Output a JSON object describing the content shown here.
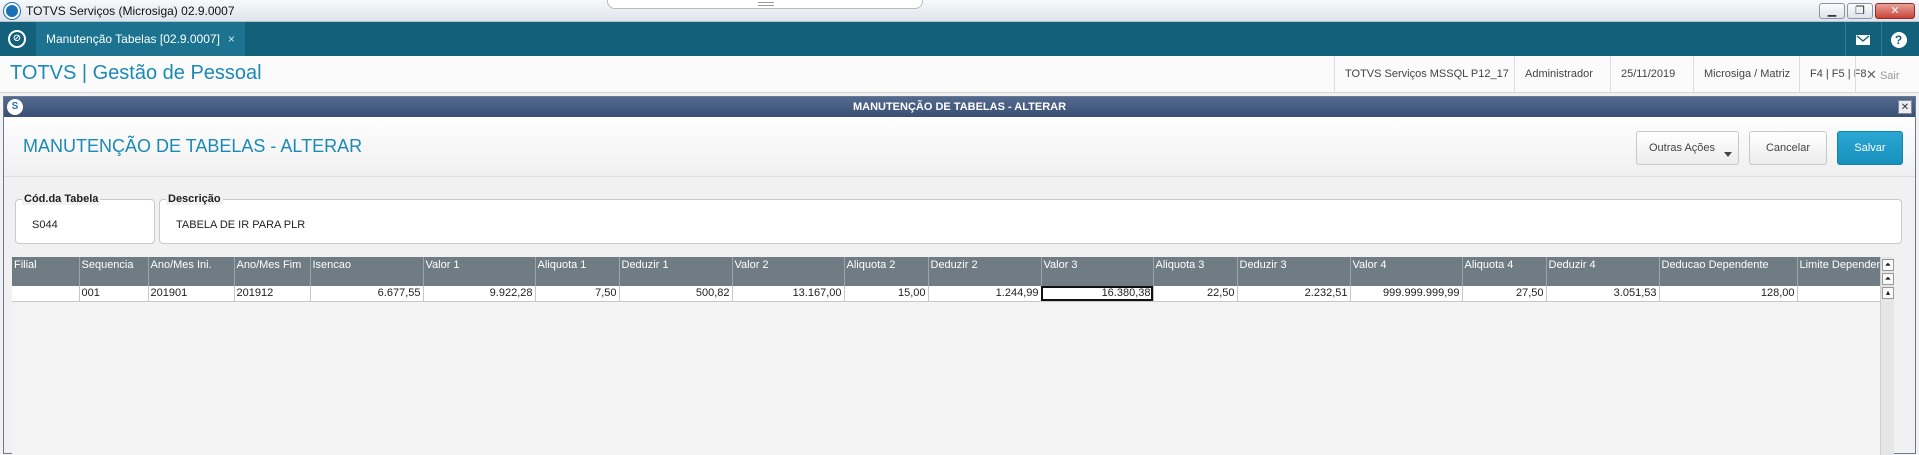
{
  "window": {
    "title": "TOTVS Serviços (Microsiga) 02.9.0007",
    "minimize": "▁",
    "restore": "❐",
    "close": "✕"
  },
  "tabbar": {
    "home_glyph": "⊘",
    "tab_label": "Manutenção Tabelas [02.9.0007]",
    "tab_close": "×",
    "help_glyph": "?"
  },
  "header": {
    "brand": "TOTVS | Gestão de Pessoal",
    "env": "TOTVS Serviços MSSQL P12_17",
    "user": "Administrador",
    "date": "25/11/2019",
    "company": "Microsiga / Matriz",
    "shortcuts": "F4 | F5 | F8",
    "exit": "Sair"
  },
  "dialog": {
    "title": "MANUTENÇÃO DE TABELAS - ALTERAR",
    "page_title": "MANUTENÇÃO DE TABELAS - ALTERAR",
    "actions": {
      "more": "Outras Ações",
      "cancel": "Cancelar",
      "save": "Salvar"
    }
  },
  "form": {
    "code": {
      "label": "Cód.da Tabela",
      "value": "S044"
    },
    "description": {
      "label": "Descrição",
      "value": "TABELA DE IR PARA PLR"
    }
  },
  "grid": {
    "headers": [
      "Filial",
      "Sequencia",
      "Ano/Mes Ini.",
      "Ano/Mes Fim",
      "Isencao",
      "Valor 1",
      "Aliquota 1",
      "Deduzir 1",
      "Valor 2",
      "Aliquota 2",
      "Deduzir 2",
      "Valor 3",
      "Aliquota 3",
      "Deduzir 3",
      "Valor 4",
      "Aliquota 4",
      "Deduzir 4",
      "Deducao Dependente",
      "Limite Dependente"
    ],
    "rows": [
      [
        "",
        "001",
        "201901",
        "201912",
        "6.677,55",
        "9.922,28",
        "7,50",
        "500,82",
        "13.167,00",
        "15,00",
        "1.244,99",
        "16.380,38",
        "22,50",
        "2.232,51",
        "999.999.999,99",
        "27,50",
        "3.051,53",
        "128,00",
        ""
      ]
    ],
    "selected_column": 11
  }
}
